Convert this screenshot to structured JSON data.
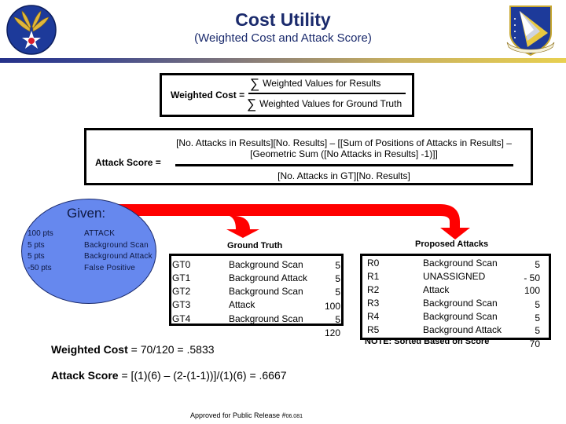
{
  "header": {
    "title": "Cost Utility",
    "subtitle": "(Weighted Cost and Attack Score)",
    "left_logo": "army-air-forces-wings-star-logo",
    "right_logo": "air-force-materiel-command-shield-logo",
    "bar_colors": [
      "#25318a",
      "#e8d050"
    ]
  },
  "weighted_cost_formula": {
    "label": "Weighted Cost =",
    "sigma": "∑",
    "numerator": "Weighted Values for Results",
    "denominator": "Weighted Values for Ground Truth"
  },
  "attack_score_formula": {
    "label": "Attack Score =",
    "numerator_line1": "[No. Attacks in Results][No. Results] – [[Sum of Positions of Attacks in Results] –",
    "numerator_line2": "[Geometric Sum ([No Attacks in Results] -1)]]",
    "denominator": "[No. Attacks in GT][No. Results]"
  },
  "given": {
    "title": "Given:",
    "items": [
      {
        "points": "100 pts",
        "type": "ATTACK"
      },
      {
        "points": "5 pts",
        "type": "Background Scan"
      },
      {
        "points": "5 pts",
        "type": "Background Attack"
      },
      {
        "points": "-50 pts",
        "type": "False Positive"
      }
    ],
    "fill_color": "#6688ee"
  },
  "arrow_color": "#ff0000",
  "ground_truth": {
    "heading": "Ground Truth",
    "rows": [
      {
        "id": "GT0",
        "type": "Background Scan",
        "value": "5"
      },
      {
        "id": "GT1",
        "type": "Background Attack",
        "value": "5"
      },
      {
        "id": "GT2",
        "type": "Background Scan",
        "value": "5"
      },
      {
        "id": "GT3",
        "type": "Attack",
        "value": "100"
      },
      {
        "id": "GT4",
        "type": "Background Scan",
        "value": "5"
      }
    ],
    "total": "120"
  },
  "proposed_attacks": {
    "heading": "Proposed Attacks",
    "rows": [
      {
        "id": "R0",
        "type": "Background Scan",
        "value": "5"
      },
      {
        "id": "R1",
        "type": "UNASSIGNED",
        "value": "- 50"
      },
      {
        "id": "R2",
        "type": "Attack",
        "value": "100"
      },
      {
        "id": "R3",
        "type": "Background Scan",
        "value": "5"
      },
      {
        "id": "R4",
        "type": "Background Scan",
        "value": "5"
      },
      {
        "id": "R5",
        "type": "Background Attack",
        "value": "5"
      }
    ],
    "note": "NOTE: Sorted Based on Score",
    "total": "70"
  },
  "results": {
    "weighted_cost_label": "Weighted Cost",
    "weighted_cost_expr": " = 70/120 = .5833",
    "attack_score_label": "Attack Score",
    "attack_score_expr": " = [(1)(6) – (2-(1-1))]/(1)(6) = .6667"
  },
  "footer": {
    "approval_text": "Approved for Public Release #",
    "approval_number": "06.081"
  }
}
